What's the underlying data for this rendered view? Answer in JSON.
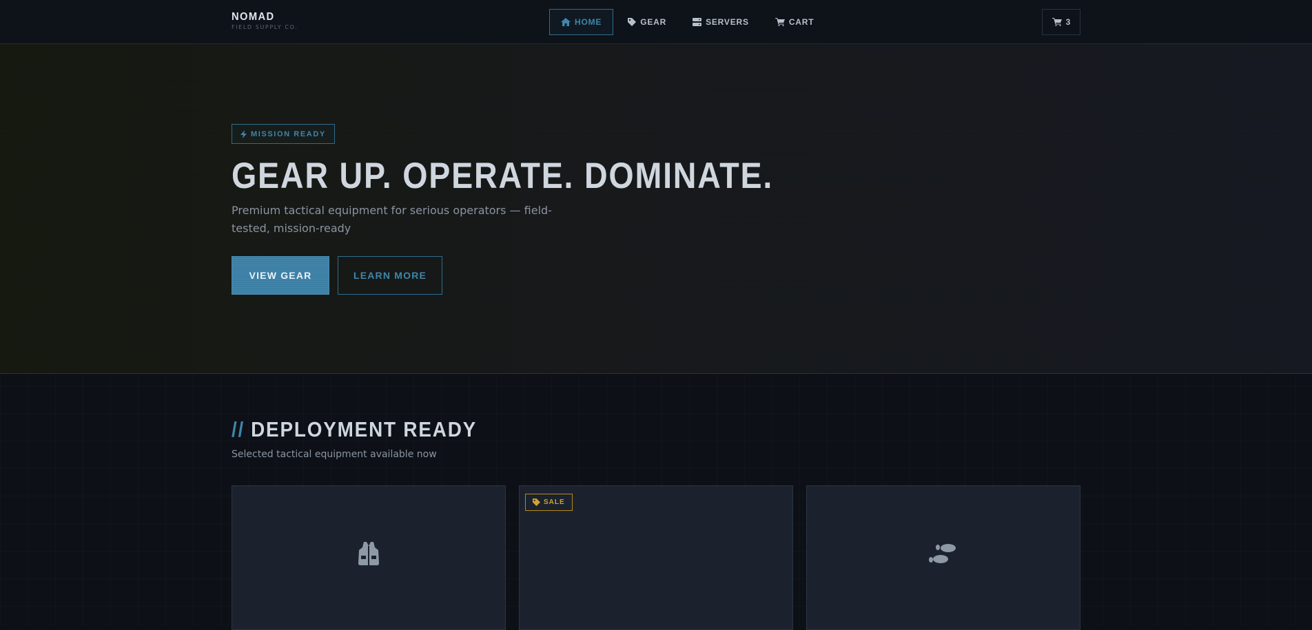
{
  "brand": {
    "name": "NOMAD",
    "tagline": "FIELD SUPPLY CO."
  },
  "nav": {
    "items": [
      {
        "label": "HOME",
        "icon": "home-icon",
        "active": true
      },
      {
        "label": "GEAR",
        "icon": "tag-icon",
        "active": false
      },
      {
        "label": "SERVERS",
        "icon": "server-icon",
        "active": false
      },
      {
        "label": "CART",
        "icon": "cart-icon",
        "active": false
      }
    ],
    "cart_count": "3"
  },
  "hero": {
    "badge": "MISSION READY",
    "title": "GEAR UP. OPERATE. DOMINATE.",
    "description": "Premium tactical equipment for serious operators — field-tested, mission-ready",
    "primary_button": "VIEW GEAR",
    "secondary_button": "LEARN MORE"
  },
  "section": {
    "prefix": "//",
    "title": "DEPLOYMENT READY",
    "subtitle": "Selected tactical equipment available now"
  },
  "products": [
    {
      "icon": "vest-icon",
      "badge": ""
    },
    {
      "icon": "",
      "badge": "SALE"
    },
    {
      "icon": "footprints-icon",
      "badge": ""
    }
  ],
  "colors": {
    "accent": "#3f86ab",
    "sale": "#d3a32b",
    "background": "#0d1117"
  }
}
